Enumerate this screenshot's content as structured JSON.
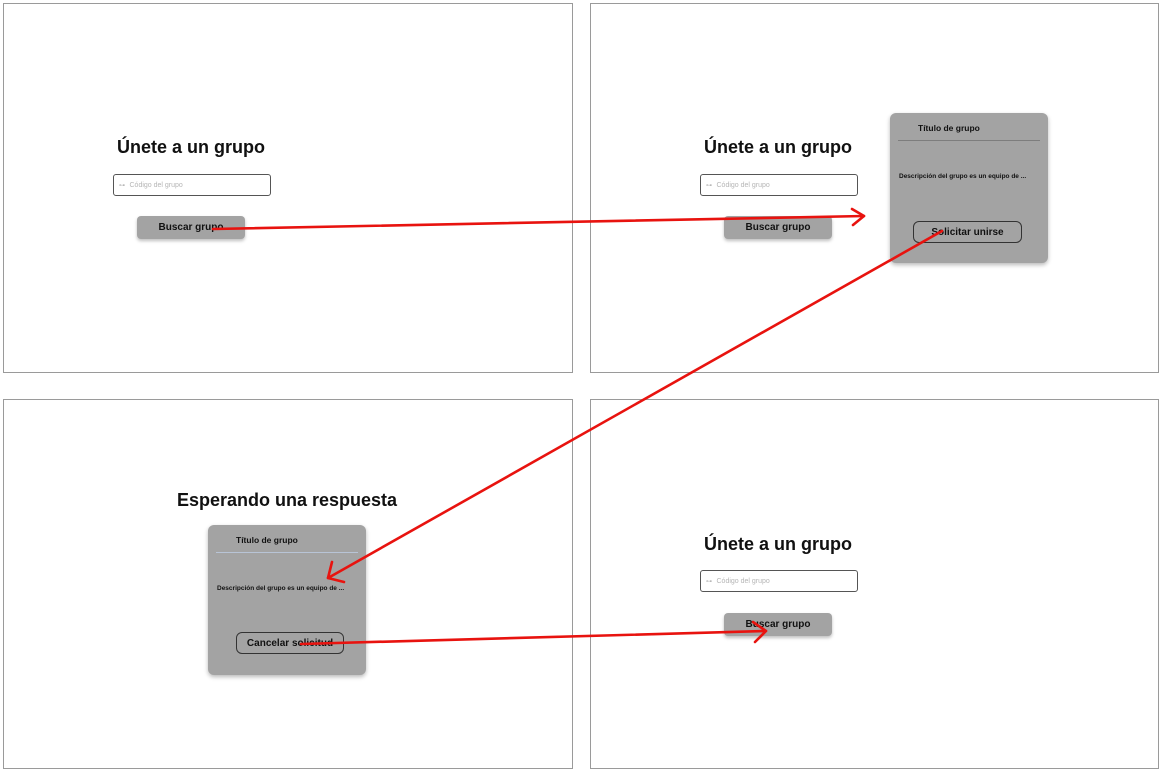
{
  "screens": [
    {
      "heading": "Únete a un grupo",
      "search_input": {
        "icon": "search-icon",
        "placeholder": "Código del grupo"
      },
      "search_button": "Buscar grupo"
    },
    {
      "heading": "Únete a un grupo",
      "search_input": {
        "icon": "search-icon",
        "placeholder": "Código del grupo"
      },
      "search_button": "Buscar grupo",
      "group_card": {
        "title": "Título de grupo",
        "description": "Descripción del grupo es un equipo de ...",
        "action": "Solicitar unirse"
      }
    },
    {
      "heading": "Esperando una respuesta",
      "group_card": {
        "title": "Título de grupo",
        "description": "Descripción del grupo es un equipo de ...",
        "action": "Cancelar solicitud"
      }
    },
    {
      "heading": "Únete a un grupo",
      "search_input": {
        "icon": "search-icon",
        "placeholder": "Código del grupo"
      },
      "search_button": "Buscar grupo"
    }
  ],
  "flow": [
    {
      "from": "Buscar grupo",
      "to": "Título de grupo"
    },
    {
      "from": "Solicitar unirse",
      "to": "Esperando una respuesta"
    },
    {
      "from": "Cancelar solicitud",
      "to": "Únete a un grupo"
    }
  ],
  "colors": {
    "arrow": "#e8130f",
    "button_fill": "#a3a3a3",
    "frame_border": "#9a9a9a"
  }
}
